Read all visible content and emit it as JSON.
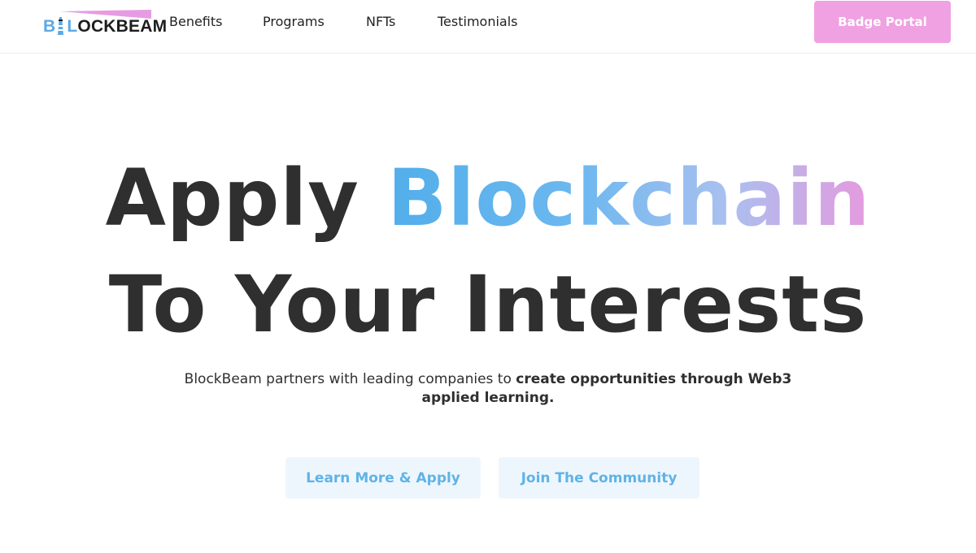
{
  "brand": {
    "logo_parts": [
      "B",
      "",
      "L",
      "OCKBEAM"
    ],
    "logo_alt": "BLOCKBEAM",
    "colors": {
      "blue": "#5aa9e8",
      "pink": "#e79be3",
      "dark": "#1d1d1d"
    }
  },
  "nav": {
    "items": [
      {
        "label": "Benefits"
      },
      {
        "label": "Programs"
      },
      {
        "label": "NFTs"
      },
      {
        "label": "Testimonials"
      }
    ],
    "badge_portal_label": "Badge Portal"
  },
  "hero": {
    "line1_plain": "Apply",
    "line1_gradient": "Blockchain",
    "line2": "To Your Interests",
    "subtitle_plain": "BlockBeam partners with leading companies to ",
    "subtitle_bold": "create opportunities through Web3 applied learning.",
    "gradient_colors": [
      "#52aeea",
      "#6db8ef",
      "#a9c0ef",
      "#e59ade"
    ]
  },
  "cta": {
    "learn_label": "Learn More & Apply",
    "join_label": "Join The Community"
  },
  "colors": {
    "badge_bg": "#f0a1e1",
    "cta_bg": "#eef6fd",
    "cta_text": "#5fb3e6",
    "heading": "#2f2f2f"
  }
}
